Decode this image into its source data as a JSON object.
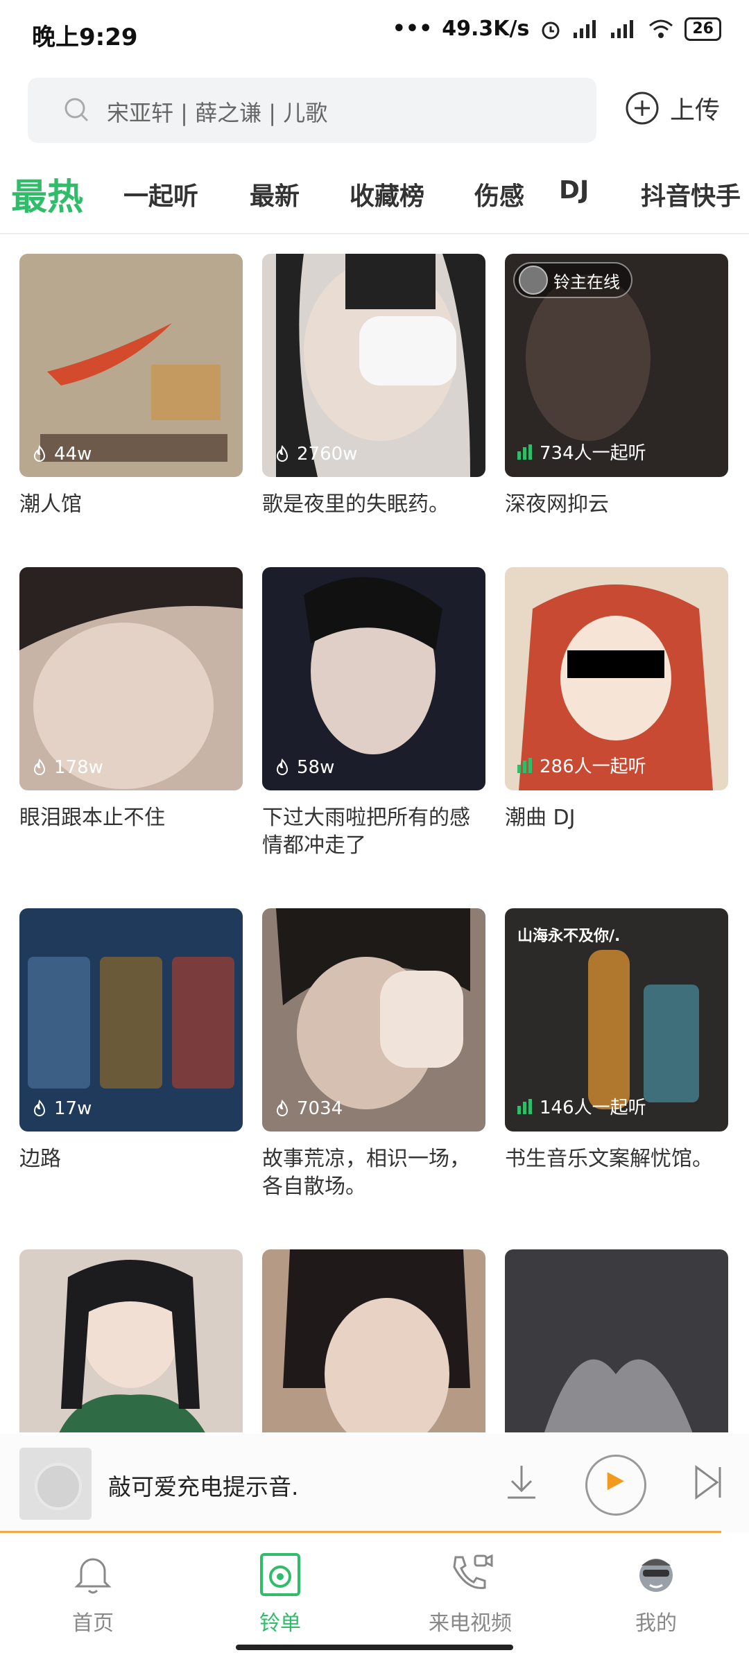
{
  "status_bar": {
    "time": "晚上9:29",
    "net_speed": "49.3K/s",
    "battery": "26"
  },
  "search": {
    "placeholder": "宋亚轩 | 薛之谦 | 儿歌",
    "upload_label": "上传"
  },
  "tabs": [
    {
      "label": "最热",
      "active": true
    },
    {
      "label": "一起听"
    },
    {
      "label": "最新"
    },
    {
      "label": "收藏榜"
    },
    {
      "label": "伤感"
    },
    {
      "label": "DJ"
    },
    {
      "label": "抖音快手"
    }
  ],
  "cards": [
    {
      "title": "潮人馆",
      "badge": "44w",
      "badge_type": "fire"
    },
    {
      "title": "歌是夜里的失眠药。",
      "badge": "2760w",
      "badge_type": "fire"
    },
    {
      "title": "深夜网抑云",
      "badge": "734人一起听",
      "badge_type": "live",
      "live_pill": "铃主在线"
    },
    {
      "title": "眼泪跟本止不住",
      "badge": "178w",
      "badge_type": "fire"
    },
    {
      "title": "下过大雨啦把所有的感情都冲走了",
      "badge": "58w",
      "badge_type": "fire"
    },
    {
      "title": "潮曲 DJ",
      "badge": "286人一起听",
      "badge_type": "live"
    },
    {
      "title": "边路",
      "badge": "17w",
      "badge_type": "fire"
    },
    {
      "title": "故事荒凉，相识一场，各自散场。",
      "badge": "7034",
      "badge_type": "fire"
    },
    {
      "title": "书生音乐文案解忧馆。",
      "badge": "146人一起听",
      "badge_type": "live",
      "overlay_text": "山海永不及你/."
    },
    {
      "title": "",
      "badge": ""
    },
    {
      "title": "",
      "badge": ""
    },
    {
      "title": "",
      "badge": ""
    }
  ],
  "thumb_colors": [
    "#b7a88f",
    "#d9d4cf",
    "#2c2624",
    "#c8b4a6",
    "#1b1e2a",
    "#c94a32",
    "#1f3a5a",
    "#8d7d72",
    "#2b2a28",
    "#2f6b45",
    "#b59a86",
    "#3c3c40"
  ],
  "player": {
    "title": "敲可爱充电提示音."
  },
  "bottom_nav": [
    {
      "label": "首页",
      "icon": "bell-icon"
    },
    {
      "label": "铃单",
      "icon": "ringtone-list-icon",
      "active": true
    },
    {
      "label": "来电视频",
      "icon": "phone-video-icon"
    },
    {
      "label": "我的",
      "icon": "profile-icon"
    }
  ],
  "colors": {
    "accent": "#2fbd6a",
    "play_accent": "#f39a1e"
  }
}
